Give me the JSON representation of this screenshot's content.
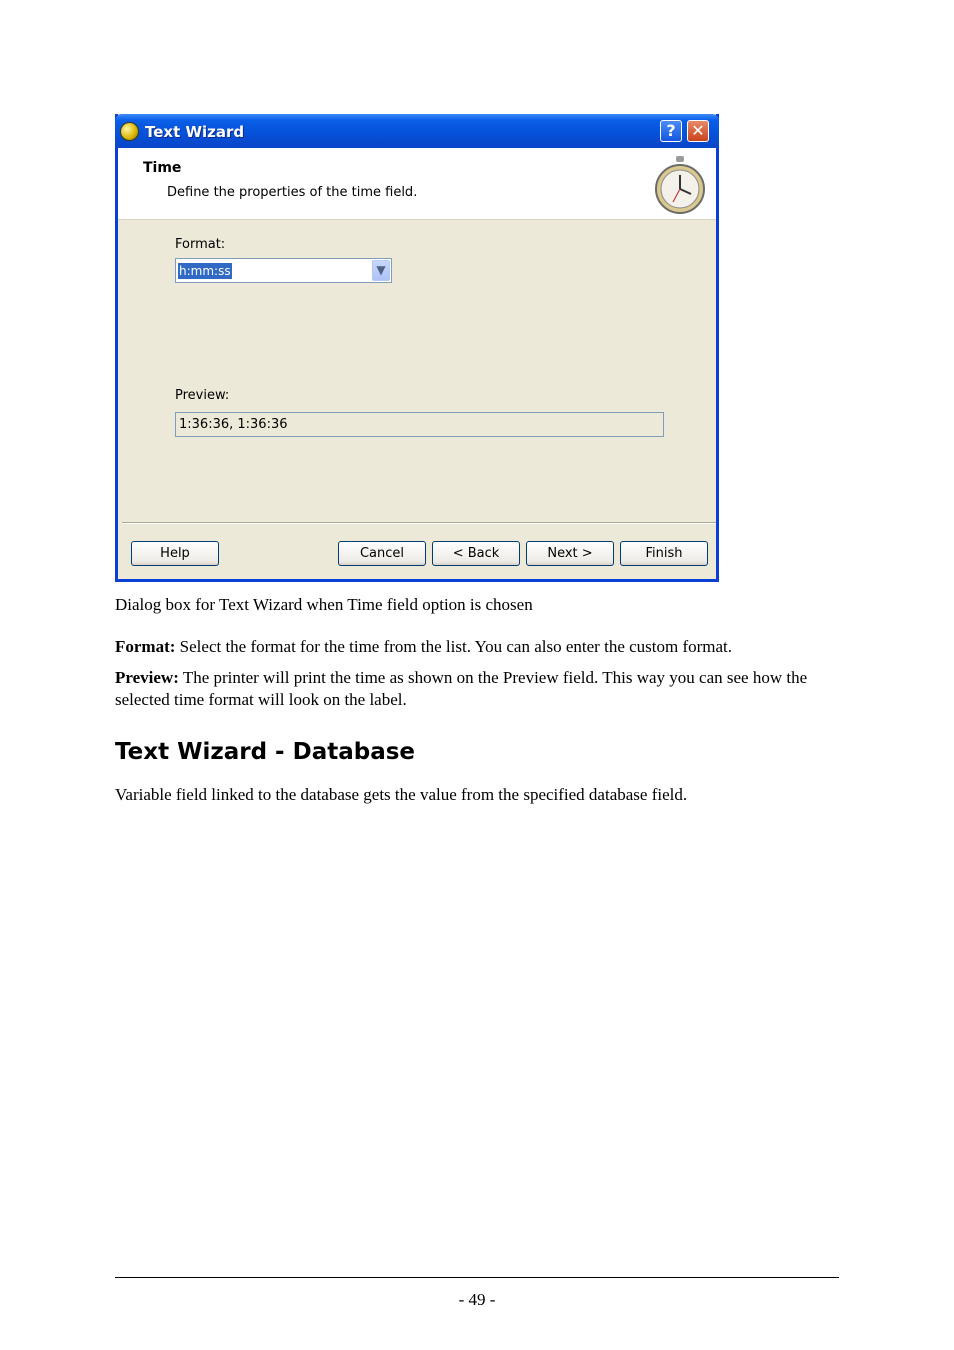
{
  "dialog": {
    "title": "Text Wizard",
    "title_help_glyph": "?",
    "title_close_glyph": "✕",
    "header_title": "Time",
    "header_subtitle": "Define the properties of the time field.",
    "header_icon": "stopwatch-icon",
    "format_label": "Format:",
    "format_value": "h:mm:ss",
    "preview_label": "Preview:",
    "preview_value": "1:36:36, 1:36:36",
    "buttons": {
      "help": "Help",
      "cancel": "Cancel",
      "back": "< Back",
      "next": "Next >",
      "finish": "Finish"
    },
    "colors": {
      "titlebar": "#0650d8",
      "face": "#ece9d8",
      "selection": "#316ac5"
    }
  },
  "document": {
    "caption": "Dialog box for Text Wizard when Time field option is chosen",
    "format_term": "Format:",
    "format_text": " Select the format for the time from the list. You can also enter the custom format.",
    "preview_term": "Preview:",
    "preview_text": " The printer will print the time as shown on the Preview field. This way you can see how the selected time format will look on the label.",
    "heading": "Text Wizard - Database",
    "db_text": "Variable field linked to the database gets the value from the specified database field.",
    "page_number": "- 49 -"
  }
}
